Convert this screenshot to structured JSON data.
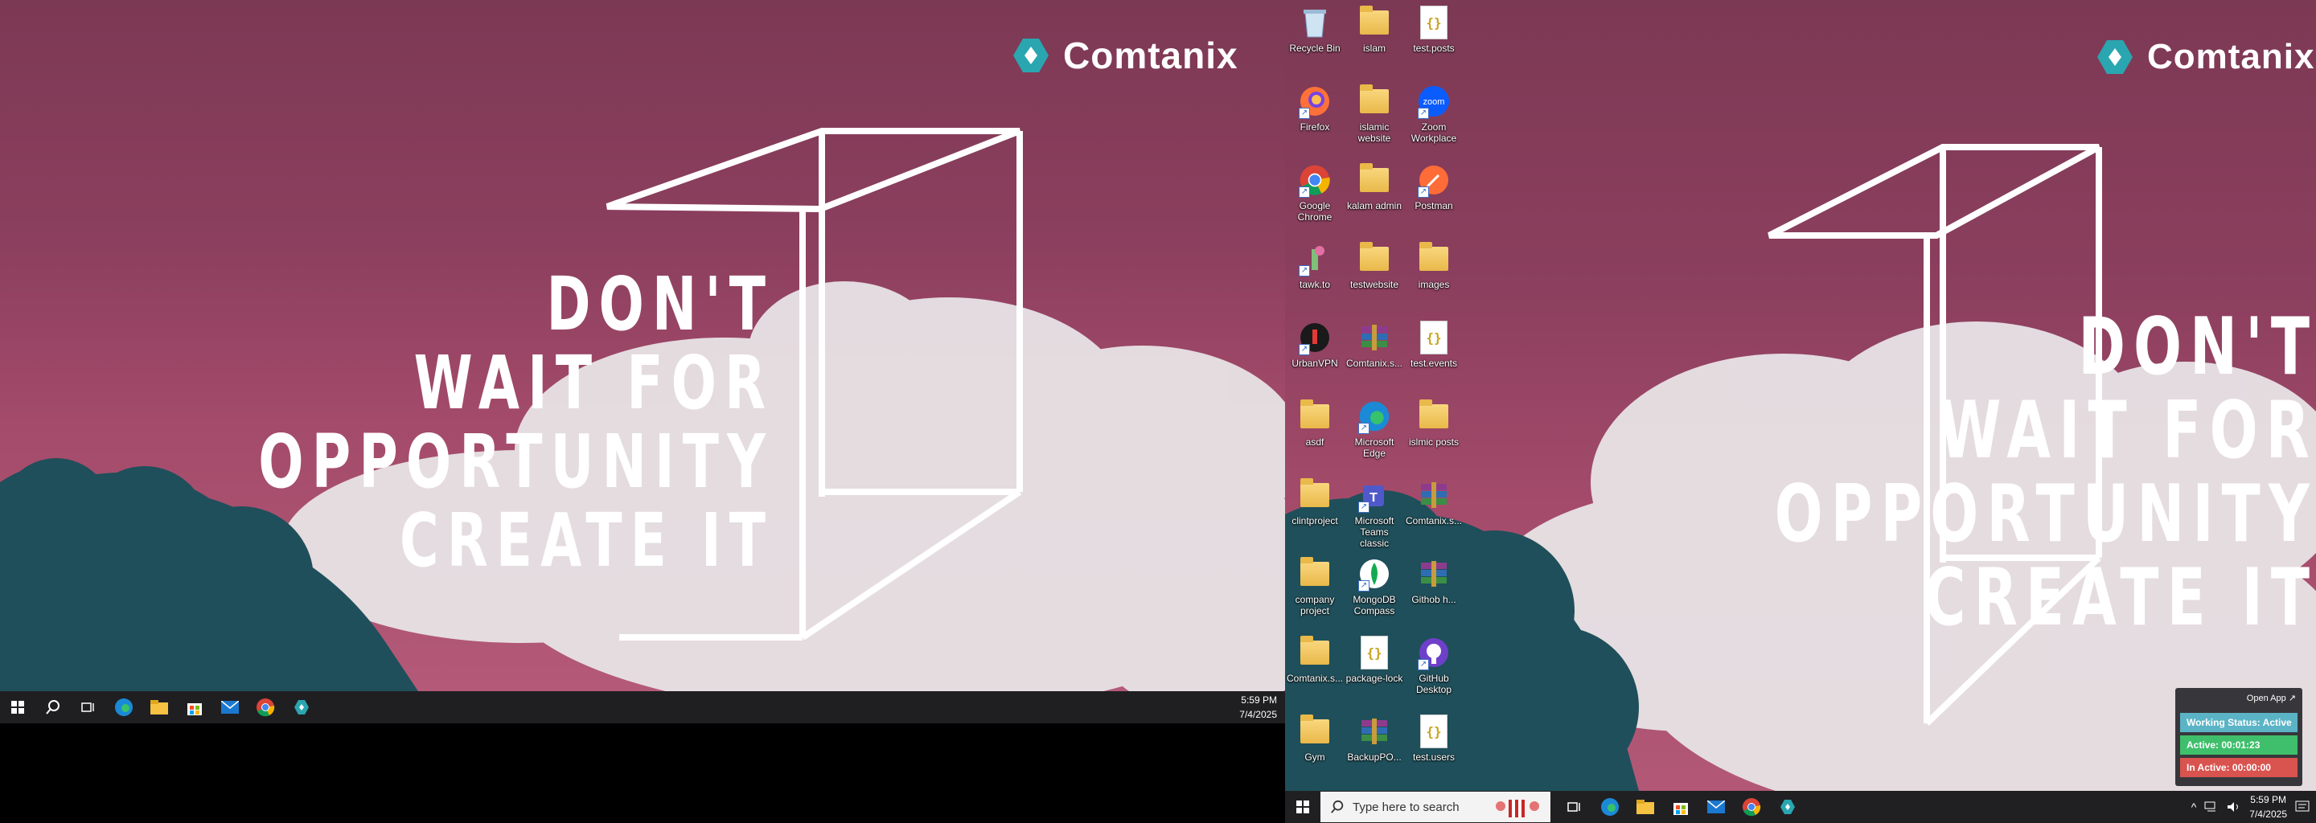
{
  "wallpaper": {
    "brand": "Comtanix",
    "slogan": [
      "DON'T",
      "WAIT FOR",
      "OPPORTUNITY",
      "CREATE IT"
    ],
    "colors": {
      "sky": "#8c3f5e",
      "text": "#ffffff",
      "logo": "#2aa6b0"
    }
  },
  "taskbar_left": {
    "icons": [
      "windows-start-icon",
      "search-icon",
      "task-view-icon",
      "edge-icon",
      "file-explorer-icon",
      "store-icon",
      "mail-icon",
      "chrome-icon",
      "comtanix-app-icon"
    ],
    "time": "5:59 PM",
    "date": "7/4/2025"
  },
  "desktop": {
    "icons": [
      {
        "label": "Recycle Bin",
        "type": "recycle"
      },
      {
        "label": "islam",
        "type": "folder"
      },
      {
        "label": "test.posts",
        "type": "json"
      },
      {
        "label": "Firefox",
        "type": "firefox"
      },
      {
        "label": "islamic website",
        "type": "folder"
      },
      {
        "label": "Zoom Workplace",
        "type": "zoom"
      },
      {
        "label": "Google Chrome",
        "type": "chrome"
      },
      {
        "label": "kalam admin",
        "type": "folder"
      },
      {
        "label": "Postman",
        "type": "postman"
      },
      {
        "label": "tawk.to",
        "type": "tawk"
      },
      {
        "label": "testwebsite",
        "type": "folder"
      },
      {
        "label": "images",
        "type": "folder"
      },
      {
        "label": "UrbanVPN",
        "type": "vpn"
      },
      {
        "label": "Comtanix.s...",
        "type": "rar"
      },
      {
        "label": "test.events",
        "type": "json"
      },
      {
        "label": "asdf",
        "type": "folder"
      },
      {
        "label": "Microsoft Edge",
        "type": "edge"
      },
      {
        "label": "islmic posts",
        "type": "folder"
      },
      {
        "label": "clintproject",
        "type": "folder"
      },
      {
        "label": "Microsoft Teams classic",
        "type": "teams"
      },
      {
        "label": "Comtanix.s...",
        "type": "rar"
      },
      {
        "label": "company project",
        "type": "folder"
      },
      {
        "label": "MongoDB Compass",
        "type": "mongo"
      },
      {
        "label": "Githob h...",
        "type": "rar"
      },
      {
        "label": "Comtanix.s...",
        "type": "folder"
      },
      {
        "label": "package-lock",
        "type": "json"
      },
      {
        "label": "GitHub Desktop",
        "type": "github"
      },
      {
        "label": "Gym",
        "type": "folder"
      },
      {
        "label": "BackupPO...",
        "type": "rar"
      },
      {
        "label": "test.users",
        "type": "json"
      }
    ]
  },
  "taskbar_right": {
    "search_placeholder": "Type here to search",
    "icons": [
      "windows-start-icon",
      "task-view-icon",
      "edge-icon",
      "file-explorer-icon",
      "store-icon",
      "mail-icon",
      "chrome-icon",
      "comtanix-app-icon"
    ],
    "time": "5:59 PM",
    "date": "7/4/2025"
  },
  "time_widget": {
    "open_label": "Open App ↗",
    "status": "Working Status: Active",
    "active": "Active: 00:01:23",
    "inactive": "In Active: 00:00:00",
    "colors": {
      "status": "#5bb4c6",
      "active": "#3fbf6b",
      "inactive": "#d9534f"
    }
  }
}
